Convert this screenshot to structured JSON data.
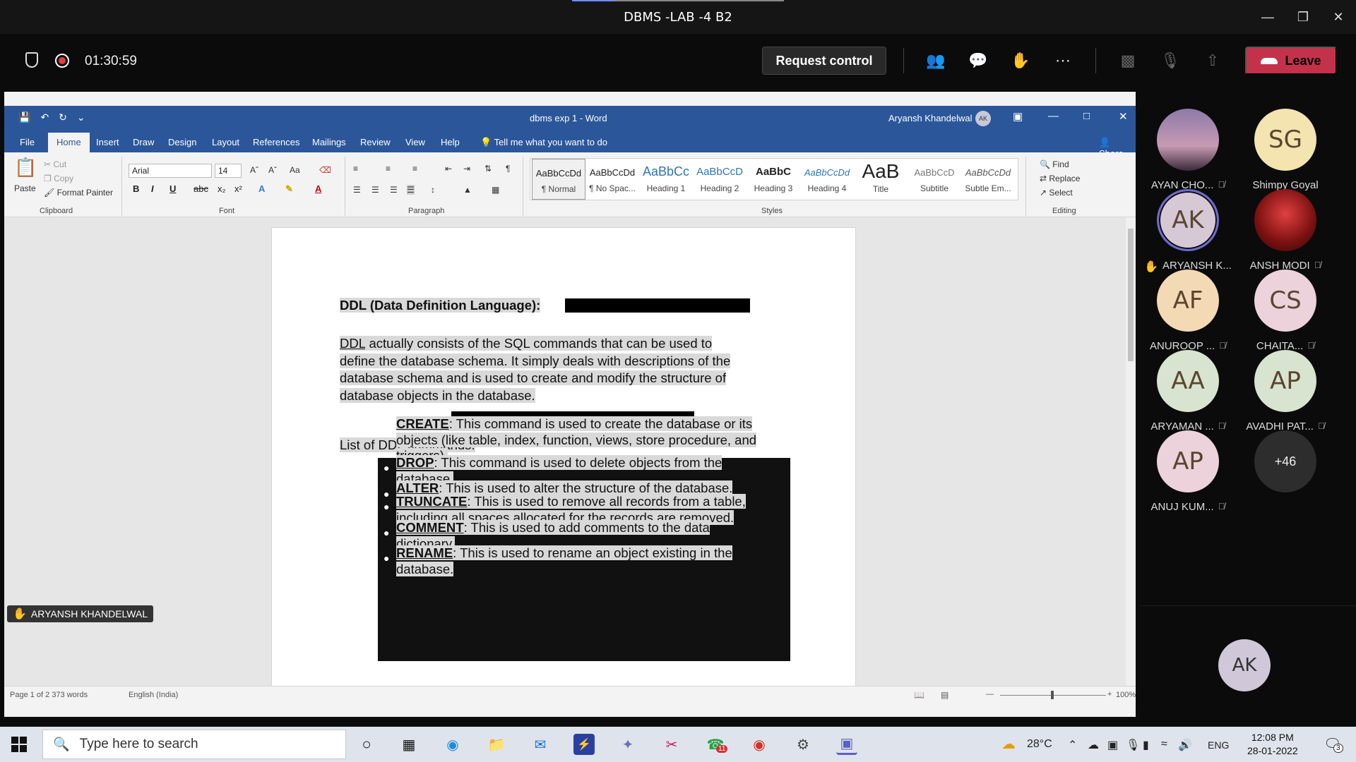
{
  "teams": {
    "window_title": "DBMS -LAB -4 B2",
    "timer": "01:30:59",
    "request_control": "Request control",
    "leave": "Leave"
  },
  "word": {
    "doc_title": "dbms exp 1  -  Word",
    "user_name": "Aryansh Khandelwal",
    "user_initials": "AK",
    "tabs": [
      "File",
      "Home",
      "Insert",
      "Draw",
      "Design",
      "Layout",
      "References",
      "Mailings",
      "Review",
      "View",
      "Help"
    ],
    "tell_me": "Tell me what you want to do",
    "share": "Share",
    "clipboard": {
      "paste": "Paste",
      "cut": "Cut",
      "copy": "Copy",
      "format_painter": "Format Painter",
      "label": "Clipboard"
    },
    "font": {
      "name": "Arial",
      "size": "14",
      "label": "Font"
    },
    "paragraph_label": "Paragraph",
    "styles_label": "Styles",
    "styles": [
      {
        "sample": "AaBbCcDd",
        "name": "¶ Normal"
      },
      {
        "sample": "AaBbCcDd",
        "name": "¶ No Spac..."
      },
      {
        "sample": "AaBbCc",
        "name": "Heading 1"
      },
      {
        "sample": "AaBbCcD",
        "name": "Heading 2"
      },
      {
        "sample": "AaBbC",
        "name": "Heading 3"
      },
      {
        "sample": "AaBbCcDd",
        "name": "Heading 4"
      },
      {
        "sample": "AaB",
        "name": "Title"
      },
      {
        "sample": "AaBbCcD",
        "name": "Subtitle"
      },
      {
        "sample": "AaBbCcDd",
        "name": "Subtle Em..."
      }
    ],
    "editing": {
      "find": "Find",
      "replace": "Replace",
      "select": "Select",
      "label": "Editing"
    },
    "document": {
      "heading": "DDL (Data Definition Language):",
      "para_term": "DDL",
      "para_rest_1": " actually consists of the SQL commands that can be used to",
      "para_line_2": "define the database schema. It simply deals with descriptions of the",
      "para_line_3": "database schema and is used to create and modify the structure of",
      "para_line_4": "database objects in the database.",
      "list_title": "List of DDL commands:",
      "items": [
        {
          "term": "CREATE",
          "l1": ": This command is used to create the database or its",
          "l2": "objects (like table, index, function, views, store procedure, and",
          "l3": "triggers)."
        },
        {
          "term": "DROP",
          "l1": ": This command is used to delete objects from the",
          "l2": "database.",
          "l3": ""
        },
        {
          "term": "ALTER",
          "l1": ": This is used to alter the structure of the database.",
          "l2": "",
          "l3": ""
        },
        {
          "term": "TRUNCATE",
          "l1": ": This is used to remove all records from a table,",
          "l2": "including all spaces allocated for the records are removed.",
          "l3": ""
        },
        {
          "term": "COMMENT",
          "l1": ": This is used to add comments to the data",
          "l2": "dictionary.",
          "l3": ""
        },
        {
          "term": "RENAME",
          "l1": ": This is used to rename an object existing in the",
          "l2": "database.",
          "l3": ""
        }
      ]
    },
    "status": {
      "words": "Page 1 of 2    373 words",
      "language": "English (India)",
      "zoom": "100%"
    }
  },
  "presenter_label": "ARYANSH KHANDELWAL",
  "participants": [
    {
      "initials": "",
      "name": "AYAN CHO...",
      "muted": true,
      "bg": "#6b5a78"
    },
    {
      "initials": "SG",
      "name": "Shimpy Goyal",
      "muted": false,
      "bg": "#f3e4b0"
    },
    {
      "initials": "AK",
      "name": "ARYANSH K...",
      "muted": false,
      "bg": "#d7c8d6",
      "hand": true
    },
    {
      "initials": "",
      "name": "ANSH MODI",
      "muted": true,
      "bg": "#8a1b1b"
    },
    {
      "initials": "AF",
      "name": "ANUROOP ...",
      "muted": true,
      "bg": "#f4d9b5"
    },
    {
      "initials": "CS",
      "name": "CHAITA...",
      "muted": true,
      "bg": "#ecd3db"
    },
    {
      "initials": "AA",
      "name": "ARYAMAN ...",
      "muted": true,
      "bg": "#d8e4d0"
    },
    {
      "initials": "AP",
      "name": "AVADHI PAT...",
      "muted": true,
      "bg": "#d8e4d0"
    },
    {
      "initials": "AP",
      "name": "ANUJ KUM...",
      "muted": true,
      "bg": "#ecd3db"
    }
  ],
  "more_count": "+46",
  "self_initials": "AK",
  "taskbar": {
    "search_placeholder": "Type here to search",
    "weather": "28°C",
    "lang": "ENG",
    "time": "12:08 PM",
    "date": "28-01-2022",
    "notif_count": "3",
    "whatsapp_badge": "11"
  }
}
